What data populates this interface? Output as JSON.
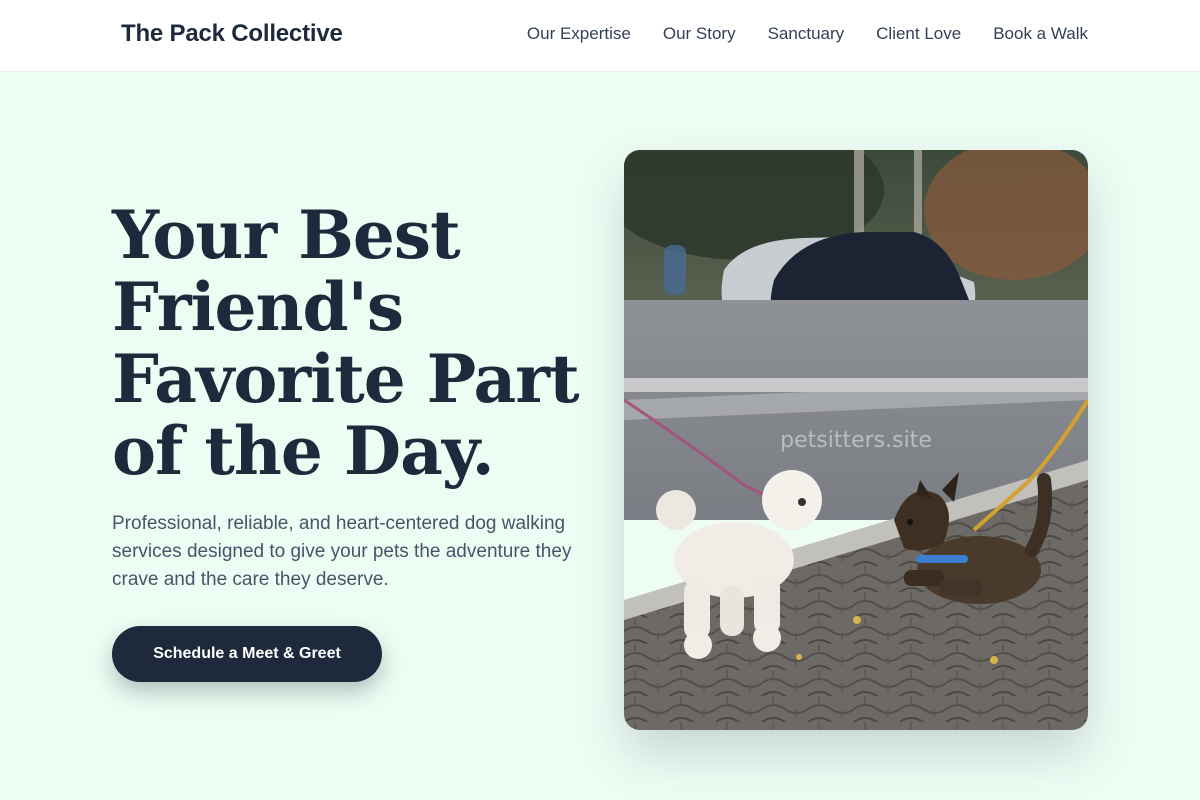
{
  "header": {
    "brand": "The Pack Collective",
    "nav": [
      {
        "label": "Our Expertise"
      },
      {
        "label": "Our Story"
      },
      {
        "label": "Sanctuary"
      },
      {
        "label": "Client Love"
      },
      {
        "label": "Book a Walk"
      }
    ]
  },
  "hero": {
    "headline": "Your Best Friend's Favorite Part of the Day.",
    "subheadline": "Professional, reliable, and heart-centered dog walking services designed to give your pets the adventure they crave and the care they deserve.",
    "cta_label": "Schedule a Meet & Greet",
    "image": {
      "watermark": "petsitters.site"
    }
  },
  "colors": {
    "background": "#eefdf4",
    "primary": "#1e293b",
    "text_muted": "#475569"
  }
}
